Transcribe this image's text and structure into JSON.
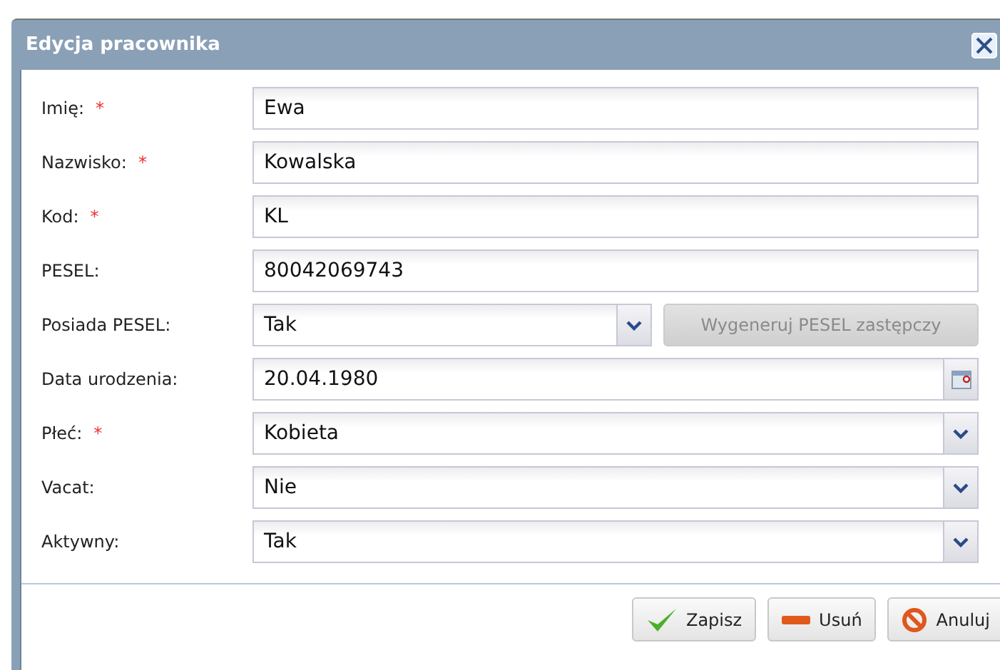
{
  "window": {
    "title": "Edycja pracownika"
  },
  "fields": [
    {
      "label": "Imię:",
      "required": true,
      "kind": "text",
      "value": "Ewa"
    },
    {
      "label": "Nazwisko:",
      "required": true,
      "kind": "text",
      "value": "Kowalska"
    },
    {
      "label": "Kod:",
      "required": true,
      "kind": "text",
      "value": "KL"
    },
    {
      "label": "PESEL:",
      "required": false,
      "kind": "text",
      "value": "80042069743"
    },
    {
      "label": "Posiada PESEL:",
      "required": false,
      "kind": "select",
      "value": "Tak",
      "button": {
        "label": "Wygeneruj PESEL zastępczy",
        "disabled": true
      }
    },
    {
      "label": "Data urodzenia:",
      "required": false,
      "kind": "date",
      "value": "20.04.1980"
    },
    {
      "label": "Płeć:",
      "required": true,
      "kind": "select",
      "value": "Kobieta"
    },
    {
      "label": "Vacat:",
      "required": false,
      "kind": "select",
      "value": "Nie"
    },
    {
      "label": "Aktywny:",
      "required": false,
      "kind": "select",
      "value": "Tak"
    }
  ],
  "required_mark": "*",
  "buttons": [
    {
      "label": "Zapisz",
      "kind": "save"
    },
    {
      "label": "Usuń",
      "kind": "delete"
    },
    {
      "label": "Anuluj",
      "kind": "cancel"
    }
  ]
}
